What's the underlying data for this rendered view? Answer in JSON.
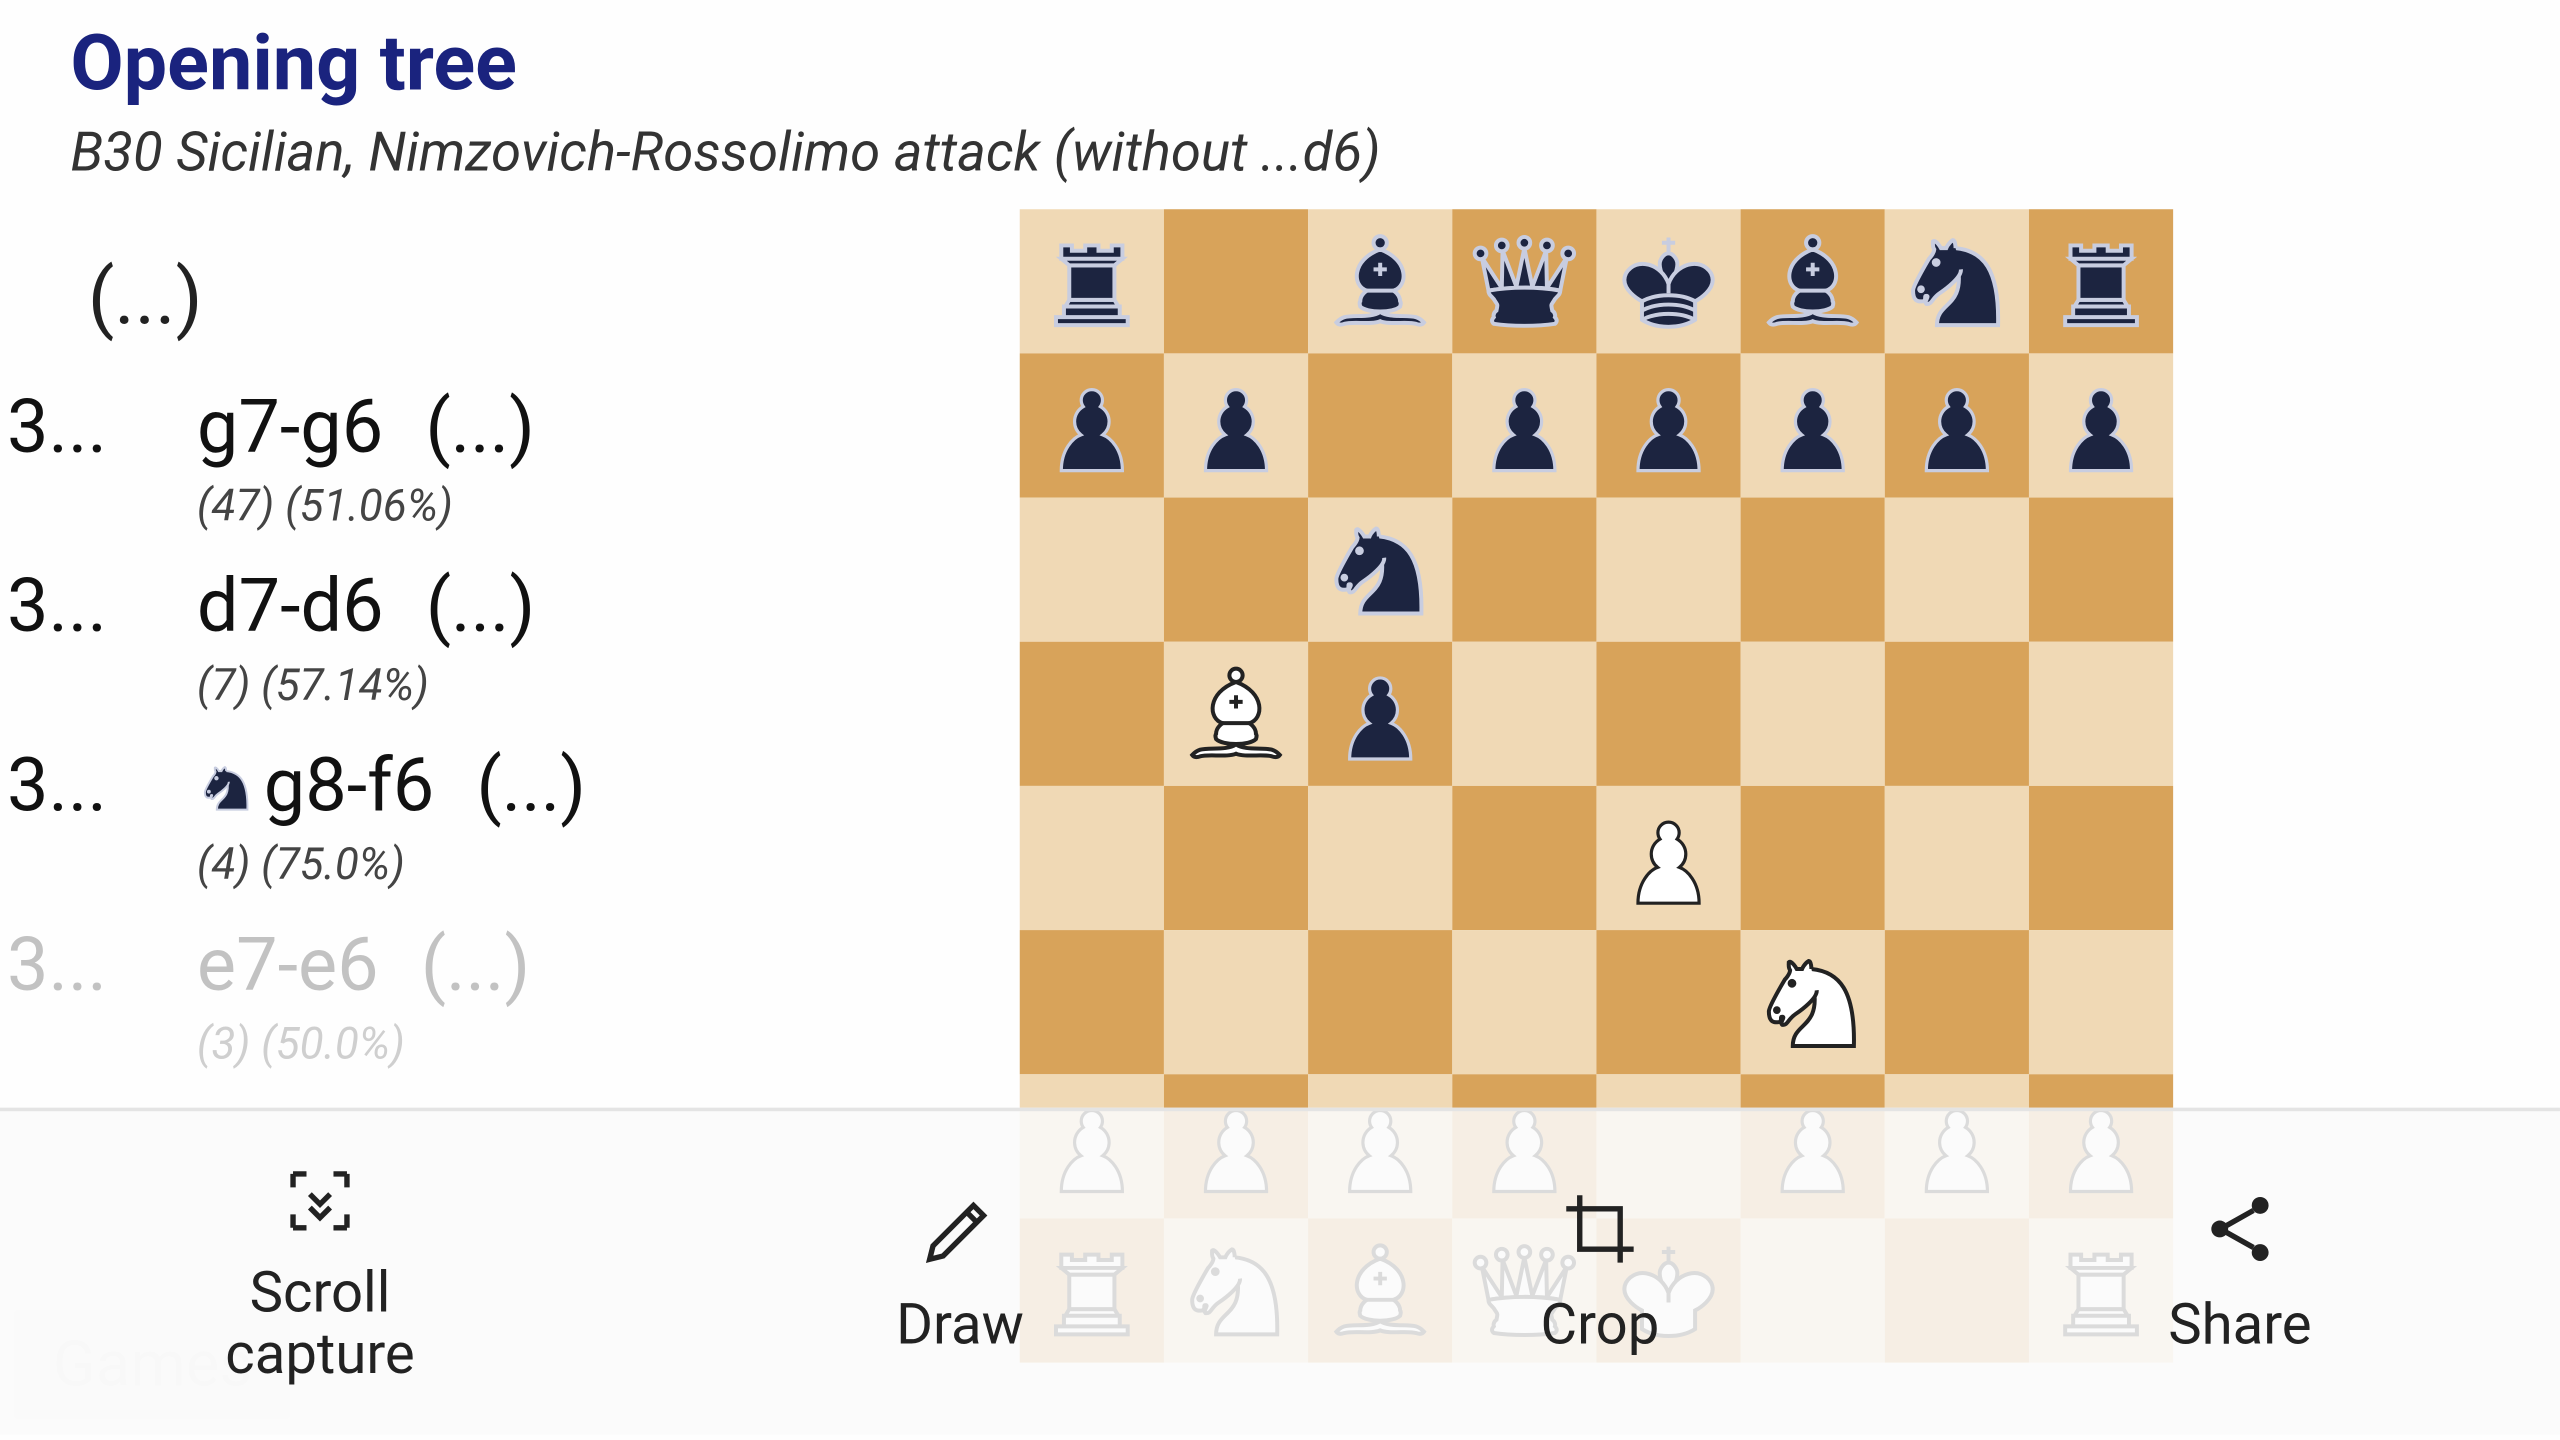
{
  "header": {
    "title": "Opening tree",
    "subtitle": "B30 Sicilian, Nimzovich-Rossolimo attack (without ...d6)"
  },
  "root_ellipsis": "(...)",
  "moves": [
    {
      "num": "3...",
      "san": "g7-g6",
      "ellipsis": "(...)",
      "stats": "(47) (51.06%)",
      "piece": ""
    },
    {
      "num": "3...",
      "san": "d7-d6",
      "ellipsis": "(...)",
      "stats": "(7) (57.14%)",
      "piece": ""
    },
    {
      "num": "3...",
      "san": "g8-f6",
      "ellipsis": "(...)",
      "stats": "(4) (75.0%)",
      "piece": "bN"
    },
    {
      "num": "3...",
      "san": "e7-e6",
      "ellipsis": "(...)",
      "stats": "(3) (50.0%)",
      "piece": "",
      "faded": true
    }
  ],
  "games_button": "Games",
  "board": {
    "squares": [
      [
        "bR",
        "",
        "bB",
        "bQ",
        "bK",
        "bB",
        "bN",
        "bR"
      ],
      [
        "bP",
        "bP",
        "",
        "bP",
        "bP",
        "bP",
        "bP",
        "bP"
      ],
      [
        "",
        "",
        "bN",
        "",
        "",
        "",
        "",
        ""
      ],
      [
        "",
        "wB",
        "bP",
        "",
        "",
        "",
        "",
        ""
      ],
      [
        "",
        "",
        "",
        "",
        "wP",
        "",
        "",
        ""
      ],
      [
        "",
        "",
        "",
        "",
        "",
        "wN",
        "",
        ""
      ],
      [
        "wP",
        "wP",
        "wP",
        "wP",
        "",
        "wP",
        "wP",
        "wP"
      ],
      [
        "wR",
        "wN",
        "wB",
        "wQ",
        "wK",
        "",
        "",
        "wR"
      ]
    ]
  },
  "toolbar": {
    "scroll_capture": "Scroll\ncapture",
    "draw": "Draw",
    "crop": "Crop",
    "share": "Share"
  }
}
